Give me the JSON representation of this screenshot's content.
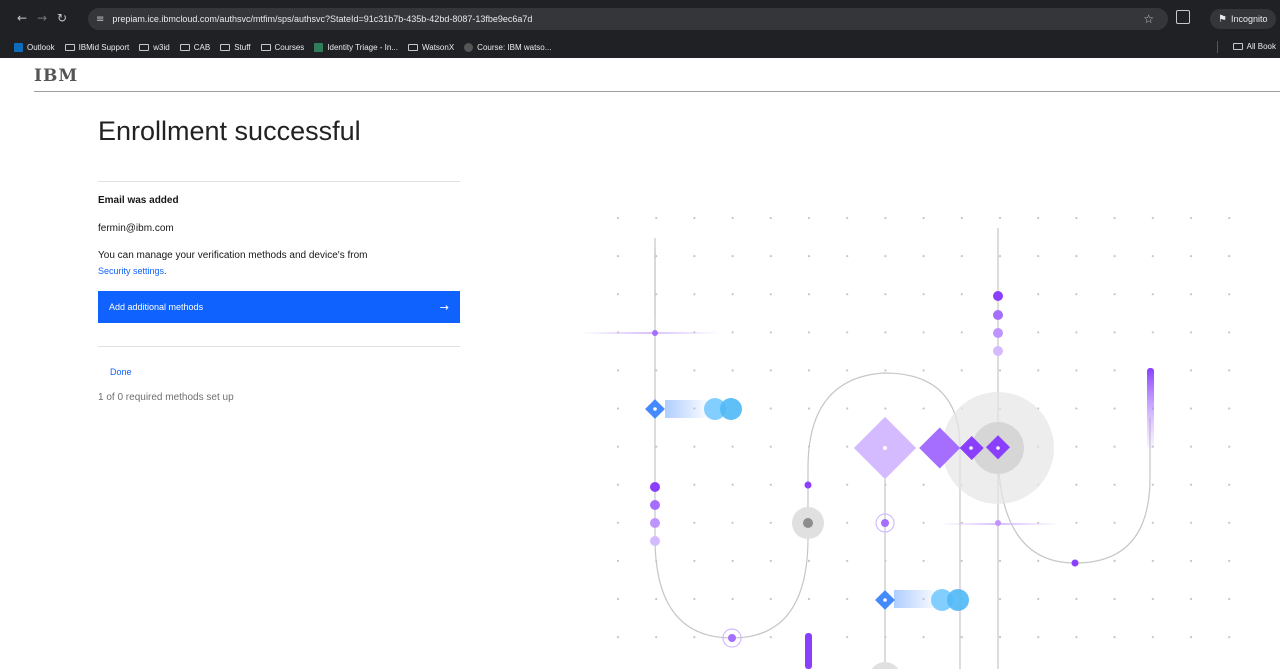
{
  "browser": {
    "url": "prepiam.ice.ibmcloud.com/authsvc/mtfim/sps/authsvc?StateId=91c31b7b-435b-42bd-8087-13fbe9ec6a7d",
    "incognito_label": "Incognito",
    "bookmarks": [
      {
        "label": "Outlook",
        "icon": "outlook-favicon"
      },
      {
        "label": "IBMid Support",
        "icon": "folder-icon"
      },
      {
        "label": "w3id",
        "icon": "folder-icon"
      },
      {
        "label": "CAB",
        "icon": "folder-icon"
      },
      {
        "label": "Stuff",
        "icon": "folder-icon"
      },
      {
        "label": "Courses",
        "icon": "folder-icon"
      },
      {
        "label": "Identity Triage - In...",
        "icon": "page-favicon"
      },
      {
        "label": "WatsonX",
        "icon": "folder-icon"
      },
      {
        "label": "Course: IBM watso...",
        "icon": "course-favicon"
      }
    ],
    "all_bookmarks_label": "All Book"
  },
  "page": {
    "logo": "IBM",
    "title": "Enrollment successful",
    "email_added_heading": "Email was added",
    "email_value": "fermin@ibm.com",
    "manage_text": "You can manage your verification methods and device's from",
    "security_link": "Security settings",
    "security_suffix": ".",
    "add_button_label": "Add additional methods",
    "done_label": "Done",
    "methods_status": "1 of 0 required methods set up"
  },
  "colors": {
    "primary_blue": "#0f62fe",
    "chrome_dark": "#202124",
    "purple": "#8a3ffc",
    "light_purple": "#be95ff",
    "cyan": "#4fb8f5"
  }
}
